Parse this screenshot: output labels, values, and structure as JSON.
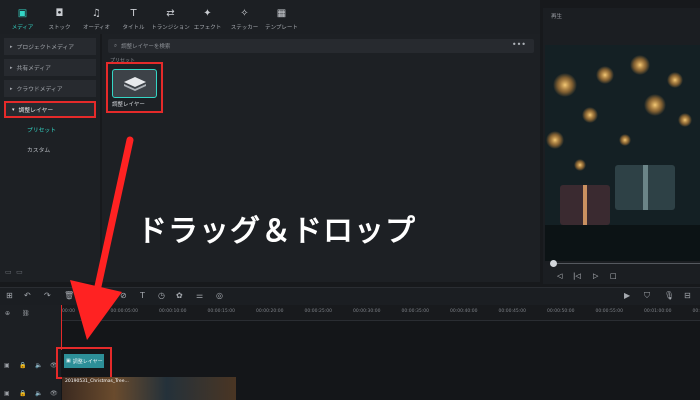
{
  "toolbar": {
    "items": [
      {
        "icon": "media-icon",
        "glyph": "▣",
        "label": "メディア",
        "active": true
      },
      {
        "icon": "stock-icon",
        "glyph": "◘",
        "label": "ストック"
      },
      {
        "icon": "audio-icon",
        "glyph": "♫",
        "label": "オーディオ"
      },
      {
        "icon": "title-icon",
        "glyph": "T",
        "label": "タイトル"
      },
      {
        "icon": "transition-icon",
        "glyph": "⇄",
        "label": "トランジション"
      },
      {
        "icon": "effect-icon",
        "glyph": "✦",
        "label": "エフェクト"
      },
      {
        "icon": "sticker-icon",
        "glyph": "✧",
        "label": "ステッカー"
      },
      {
        "icon": "template-icon",
        "glyph": "▦",
        "label": "テンプレート"
      }
    ]
  },
  "sidebar": {
    "categories": [
      {
        "label": "プロジェクトメディア"
      },
      {
        "label": "共有メディア"
      },
      {
        "label": "クラウドメディア"
      },
      {
        "label": "調整レイヤー",
        "selected": true
      }
    ],
    "subitems": [
      {
        "label": "プリセット",
        "active": true
      },
      {
        "label": "カスタム"
      }
    ]
  },
  "content": {
    "search_placeholder": "調整レイヤーを検索",
    "more": "•••",
    "section_label": "プリセット",
    "asset_name": "調整レイヤー"
  },
  "overlay": {
    "drag_text": "ドラッグ＆ドロップ"
  },
  "preview": {
    "title": "再生"
  },
  "timeline": {
    "ruler": [
      "00:00",
      "00:00:05:00",
      "00:00:10:00",
      "00:00:15:00",
      "00:00:20:00",
      "00:00:25:00",
      "00:00:30:00",
      "00:00:35:00",
      "00:00:40:00",
      "00:00:45:00",
      "00:00:50:00",
      "00:00:55:00",
      "00:01:00:00",
      "00:01:05:00"
    ],
    "adjustment_clip": "調整レイヤー",
    "video_clip": "20190531_Christmas_Tree..."
  },
  "colors": {
    "accent": "#34d6c6",
    "highlight": "#e52a2a"
  }
}
